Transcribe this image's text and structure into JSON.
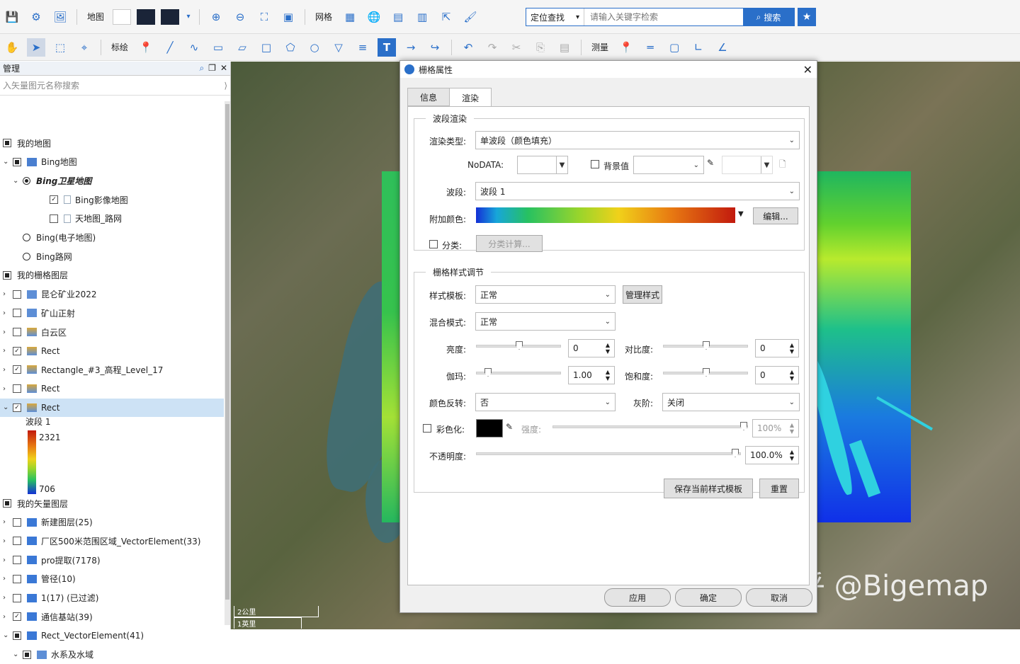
{
  "toolbar": {
    "map_label": "地图",
    "grid_label": "网格",
    "annotate_label": "标绘",
    "measure_label": "测量",
    "search_mode": "定位查找",
    "search_placeholder": "请输入关键字检索",
    "search_button": "搜索"
  },
  "panel": {
    "title": "管理",
    "search_placeholder": "入矢量图元名称搜索",
    "tree": [
      {
        "label": "我的地图",
        "level": 0,
        "check": "fill",
        "arrow": "",
        "icon": ""
      },
      {
        "label": "Bing地图",
        "level": 1,
        "check": "fill",
        "arrow": "v",
        "icon": "map"
      },
      {
        "label": "Bing卫星地图",
        "level": 2,
        "check": "radio-on",
        "arrow": "v",
        "icon": "",
        "italic": true
      },
      {
        "label": "Bing影像地图",
        "level": 3,
        "check": "checked",
        "arrow": "",
        "icon": "page"
      },
      {
        "label": "天地图_路网",
        "level": 3,
        "check": "",
        "arrow": "",
        "icon": "page"
      },
      {
        "label": "Bing(电子地图)",
        "level": 2,
        "check": "radio",
        "arrow": "",
        "icon": ""
      },
      {
        "label": "Bing路网",
        "level": 2,
        "check": "radio",
        "arrow": "",
        "icon": ""
      },
      {
        "label": "我的栅格图层",
        "level": 0,
        "check": "fill",
        "arrow": "",
        "icon": ""
      },
      {
        "label": "昆仑矿业2022",
        "level": 1,
        "check": "",
        "arrow": ">",
        "icon": "raster"
      },
      {
        "label": "矿山正射",
        "level": 1,
        "check": "",
        "arrow": ">",
        "icon": "raster"
      },
      {
        "label": "白云区",
        "level": 1,
        "check": "",
        "arrow": ">",
        "icon": "dem"
      },
      {
        "label": "Rect",
        "level": 1,
        "check": "checked",
        "arrow": ">",
        "icon": "dem"
      },
      {
        "label": "Rectangle_#3_高程_Level_17",
        "level": 1,
        "check": "checked",
        "arrow": ">",
        "icon": "dem"
      },
      {
        "label": "Rect",
        "level": 1,
        "check": "",
        "arrow": ">",
        "icon": "dem"
      },
      {
        "label": "Rect",
        "level": 1,
        "check": "checked",
        "arrow": "v",
        "icon": "dem",
        "selected": true
      }
    ],
    "legend": {
      "band": "波段 1",
      "max": "2321",
      "min": "706"
    },
    "tree2": [
      {
        "label": "我的矢量图层",
        "level": 0,
        "check": "fill",
        "arrow": "",
        "icon": ""
      },
      {
        "label": "新建图层(25)",
        "level": 1,
        "check": "",
        "arrow": ">",
        "icon": "vec"
      },
      {
        "label": "厂区500米范围区域_VectorElement(33)",
        "level": 1,
        "check": "",
        "arrow": ">",
        "icon": "vec"
      },
      {
        "label": "pro提取(7178)",
        "level": 1,
        "check": "",
        "arrow": ">",
        "icon": "vec"
      },
      {
        "label": "管径(10)",
        "level": 1,
        "check": "",
        "arrow": ">",
        "icon": "vec"
      },
      {
        "label": "1(17) (已过滤)",
        "level": 1,
        "check": "",
        "arrow": ">",
        "icon": "vec"
      },
      {
        "label": "通信基站(39)",
        "level": 1,
        "check": "checked",
        "arrow": ">",
        "icon": "vec"
      },
      {
        "label": "Rect_VectorElement(41)",
        "level": 1,
        "check": "fill",
        "arrow": "v",
        "icon": "vec"
      },
      {
        "label": "水系及水域",
        "level": 2,
        "check": "fill",
        "arrow": "v",
        "icon": "folder"
      }
    ]
  },
  "map": {
    "scale1": "2公里",
    "scale2": "1英里",
    "watermark": "知乎 @Bigemap"
  },
  "dialog": {
    "title": "栅格属性",
    "tabs": [
      "信息",
      "渲染"
    ],
    "band_render": {
      "legend": "波段渲染",
      "render_type_label": "渲染类型:",
      "render_type": "单波段（颜色填充）",
      "nodata_label": "NoDATA:",
      "bg_label": "背景值",
      "band_label": "波段:",
      "band": "波段 1",
      "color_label": "附加颜色:",
      "edit_button": "编辑...",
      "classify_label": "分类:",
      "classify_button": "分类计算..."
    },
    "style_adjust": {
      "legend": "栅格样式调节",
      "template_label": "样式模板:",
      "template": "正常",
      "manage_button": "管理样式",
      "blend_label": "混合模式:",
      "blend": "正常",
      "brightness_label": "亮度:",
      "brightness": "0",
      "contrast_label": "对比度:",
      "contrast": "0",
      "gamma_label": "伽玛:",
      "gamma": "1.00",
      "saturation_label": "饱和度:",
      "saturation": "0",
      "invert_label": "颜色反转:",
      "invert": "否",
      "gray_label": "灰阶:",
      "gray": "关闭",
      "colorize_label": "彩色化:",
      "strength_label": "强度:",
      "strength": "100%",
      "opacity_label": "不透明度:",
      "opacity": "100.0%",
      "save_button": "保存当前样式模板",
      "reset_button": "重置"
    },
    "apply_button": "应用",
    "ok_button": "确定",
    "cancel_button": "取消"
  }
}
